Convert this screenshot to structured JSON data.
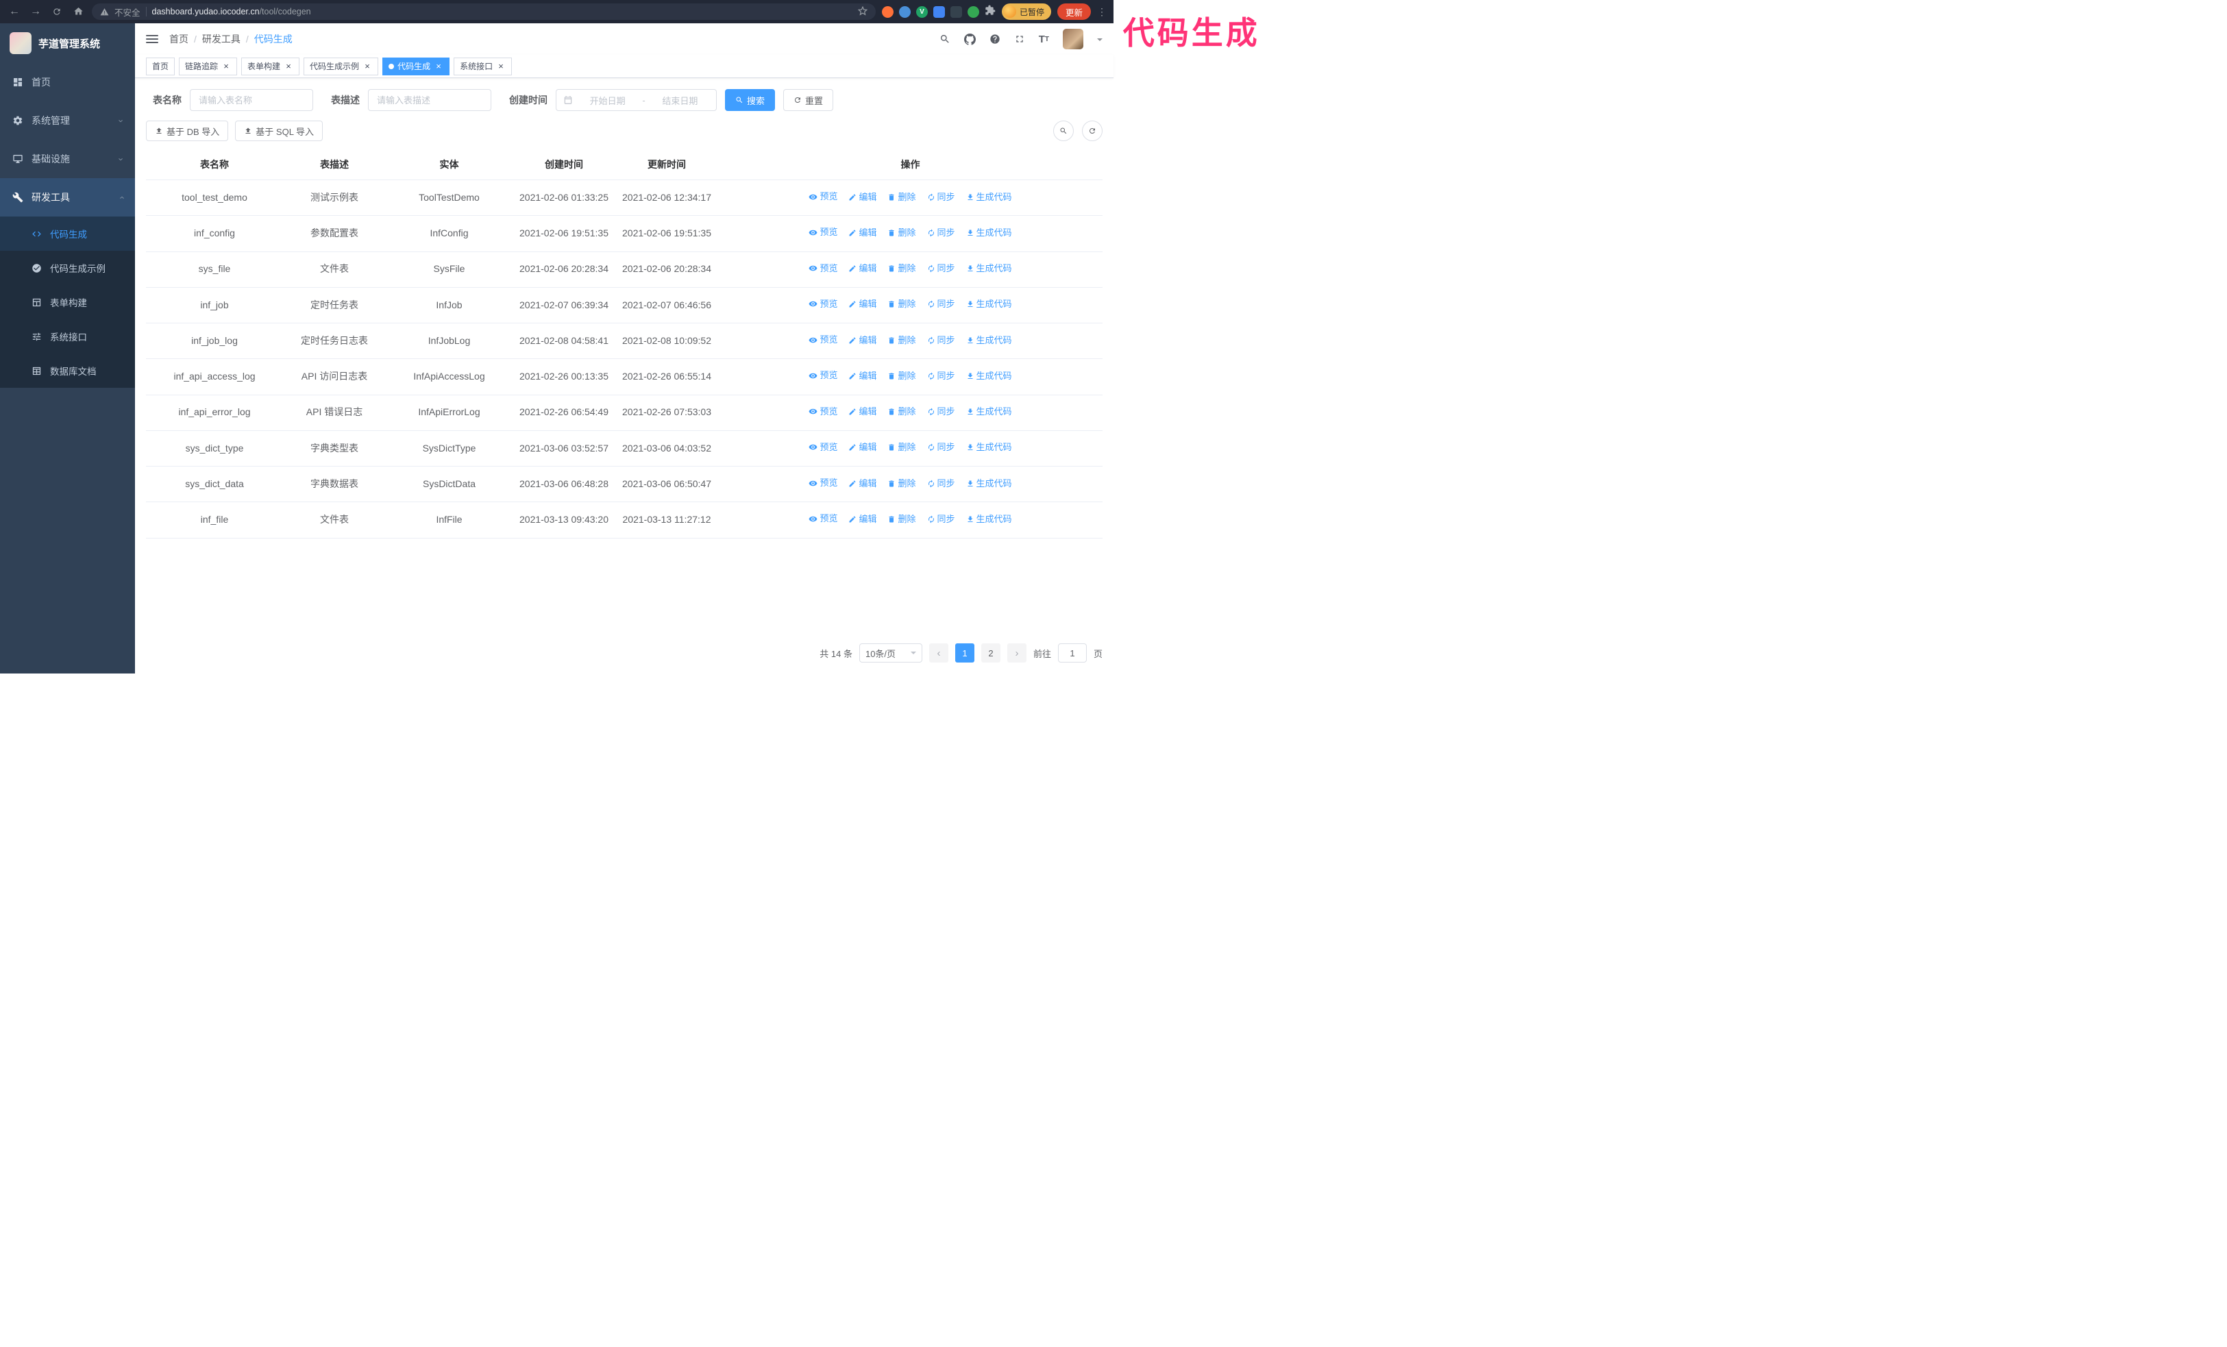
{
  "browser": {
    "security_label": "不安全",
    "url_domain": "dashboard.yudao.iocoder.cn",
    "url_path": "/tool/codegen",
    "profile_badge": "已暂停",
    "update_button": "更新"
  },
  "annotation": {
    "text": "代码生成",
    "color": "#ff3377"
  },
  "sidebar": {
    "logo_title": "芋道管理系统",
    "items": [
      {
        "label": "首页"
      },
      {
        "label": "系统管理"
      },
      {
        "label": "基础设施"
      },
      {
        "label": "研发工具"
      }
    ],
    "sub_items": [
      {
        "label": "代码生成"
      },
      {
        "label": "代码生成示例"
      },
      {
        "label": "表单构建"
      },
      {
        "label": "系统接口"
      },
      {
        "label": "数据库文档"
      }
    ]
  },
  "topbar": {
    "breadcrumb": [
      "首页",
      "研发工具",
      "代码生成"
    ],
    "separator": "/"
  },
  "tabs": [
    {
      "label": "首页",
      "closable": false,
      "active": false
    },
    {
      "label": "链路追踪",
      "closable": true,
      "active": false
    },
    {
      "label": "表单构建",
      "closable": true,
      "active": false
    },
    {
      "label": "代码生成示例",
      "closable": true,
      "active": false
    },
    {
      "label": "代码生成",
      "closable": true,
      "active": true
    },
    {
      "label": "系统接口",
      "closable": true,
      "active": false
    }
  ],
  "search_form": {
    "table_name_label": "表名称",
    "table_name_placeholder": "请输入表名称",
    "table_desc_label": "表描述",
    "table_desc_placeholder": "请输入表描述",
    "create_time_label": "创建时间",
    "date_start_placeholder": "开始日期",
    "date_separator": "-",
    "date_end_placeholder": "结束日期",
    "search_button": "搜索",
    "reset_button": "重置"
  },
  "toolbar": {
    "import_db_button": "基于 DB 导入",
    "import_sql_button": "基于 SQL 导入"
  },
  "table": {
    "columns": [
      "表名称",
      "表描述",
      "实体",
      "创建时间",
      "更新时间",
      "操作"
    ],
    "actions": [
      "预览",
      "编辑",
      "删除",
      "同步",
      "生成代码"
    ],
    "rows": [
      {
        "name": "tool_test_demo",
        "desc": "测试示例表",
        "entity": "ToolTestDemo",
        "create_time": "2021-02-06 01:33:25",
        "update_time": "2021-02-06 12:34:17"
      },
      {
        "name": "inf_config",
        "desc": "参数配置表",
        "entity": "InfConfig",
        "create_time": "2021-02-06 19:51:35",
        "update_time": "2021-02-06 19:51:35"
      },
      {
        "name": "sys_file",
        "desc": "文件表",
        "entity": "SysFile",
        "create_time": "2021-02-06 20:28:34",
        "update_time": "2021-02-06 20:28:34"
      },
      {
        "name": "inf_job",
        "desc": "定时任务表",
        "entity": "InfJob",
        "create_time": "2021-02-07 06:39:34",
        "update_time": "2021-02-07 06:46:56"
      },
      {
        "name": "inf_job_log",
        "desc": "定时任务日志表",
        "entity": "InfJobLog",
        "create_time": "2021-02-08 04:58:41",
        "update_time": "2021-02-08 10:09:52"
      },
      {
        "name": "inf_api_access_log",
        "desc": "API 访问日志表",
        "entity": "InfApiAccessLog",
        "create_time": "2021-02-26 00:13:35",
        "update_time": "2021-02-26 06:55:14"
      },
      {
        "name": "inf_api_error_log",
        "desc": "API 错误日志",
        "entity": "InfApiErrorLog",
        "create_time": "2021-02-26 06:54:49",
        "update_time": "2021-02-26 07:53:03"
      },
      {
        "name": "sys_dict_type",
        "desc": "字典类型表",
        "entity": "SysDictType",
        "create_time": "2021-03-06 03:52:57",
        "update_time": "2021-03-06 04:03:52"
      },
      {
        "name": "sys_dict_data",
        "desc": "字典数据表",
        "entity": "SysDictData",
        "create_time": "2021-03-06 06:48:28",
        "update_time": "2021-03-06 06:50:47"
      },
      {
        "name": "inf_file",
        "desc": "文件表",
        "entity": "InfFile",
        "create_time": "2021-03-13 09:43:20",
        "update_time": "2021-03-13 11:27:12"
      }
    ]
  },
  "pagination": {
    "total_text": "共 14 条",
    "page_size": "10条/页",
    "pages": [
      "1",
      "2"
    ],
    "goto_label": "前往",
    "goto_value": "1",
    "goto_unit": "页"
  }
}
